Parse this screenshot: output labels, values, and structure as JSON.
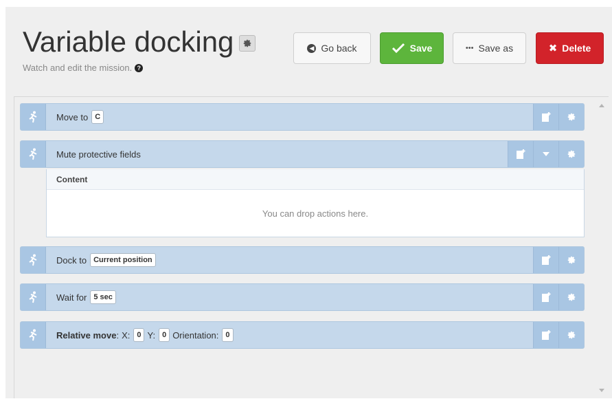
{
  "header": {
    "title": "Variable docking",
    "subtitle": "Watch and edit the mission.",
    "title_icon": "gear-icon",
    "help_icon": "question-circle-icon"
  },
  "toolbar": {
    "back_label": "Go back",
    "save_label": "Save",
    "saveas_label": "Save as",
    "delete_label": "Delete"
  },
  "actions": [
    {
      "label": "Move to",
      "params": [
        "C"
      ]
    },
    {
      "label": "Mute protective fields",
      "expanded": true,
      "content_header": "Content",
      "drop_text": "You can drop actions here."
    },
    {
      "label": "Dock to",
      "params": [
        "Current position"
      ]
    },
    {
      "label": "Wait for",
      "params": [
        "5 sec"
      ]
    },
    {
      "label_bold": "Relative move",
      "x_label": "X:",
      "x": "0",
      "y_label": "Y:",
      "y": "0",
      "orientation_label": "Orientation:",
      "orientation": "0"
    }
  ],
  "colors": {
    "save": "#5db53c",
    "delete": "#d2232a",
    "row_bg": "#c5d8eb",
    "row_icon_bg": "#a9c6e3"
  }
}
